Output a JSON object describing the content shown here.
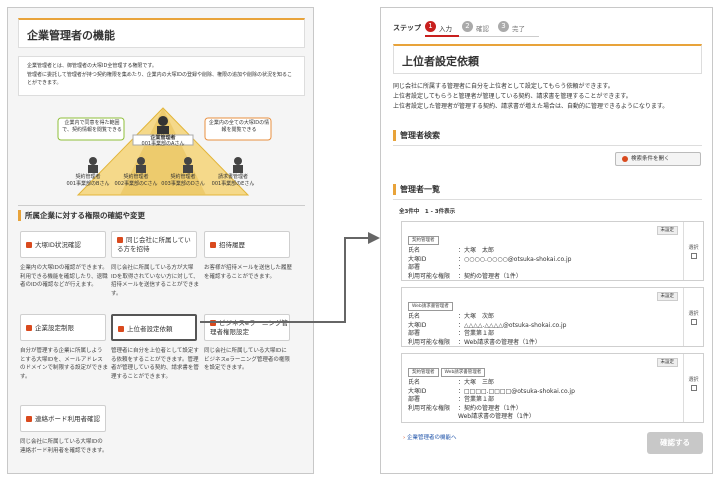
{
  "left": {
    "title": "企業管理者の機能",
    "intro": "企業管理者とは、御管理者の大塚ID全管理する権限です。\n管理者に委託して管理者が持つ契約権限を集めたり、企業内の大塚IDの登録や削除、権限の追加や削除の状況を知ることができます。",
    "diagram": {
      "bubble_left": "企業内で同意を得た範囲で、契約情報を閲覧できる",
      "bubble_right": "企業内の全ての大塚IDの情報を閲覧できる",
      "top_role": "企業管理者",
      "top_name": "001事業部のAさん",
      "people": [
        {
          "role": "契約管理者",
          "name": "001事業部のBさん"
        },
        {
          "role": "契約管理者",
          "name": "002事業部のCさん"
        },
        {
          "role": "契約管理者",
          "name": "003事業部のDさん"
        },
        {
          "role": "請求書管理者",
          "name": "001事業部のEさん"
        }
      ]
    },
    "section_title": "所属企業に対する権限の確認や変更",
    "cards": [
      {
        "label": "大塚ID状況確認",
        "desc": "企業内の大塚IDの確認ができます。利用できる機能を確認したり、退職者のIDの確認などが行えます。"
      },
      {
        "label": "同じ会社に所属している方を招待",
        "desc": "同じ会社に所属している方が大塚IDを取得されていない方に対して、招待メールを送信することができます。"
      },
      {
        "label": "招待履歴",
        "desc": "お客様が招待メールを送信した履歴を確認することができます。"
      },
      {
        "label": "企業設定制限",
        "desc": "自分が管理する企業に所属しようとする大塚IDを、メールアドレスのドメインで制限する設定ができます。"
      },
      {
        "label": "上位者設定依頼",
        "desc": "管理者に自分を上位者として設定する依頼をすることができます。管理者が管理している契約、請求書を管理することができます。"
      },
      {
        "label": "ビジネスeラーニング管理者権限設定",
        "desc": "同じ会社に所属している大塚IDにビジネスeラーニング管理者の権限を設定できます。"
      },
      {
        "label": "連絡ボード利用者確認",
        "desc": "同じ会社に所属している大塚IDの連絡ボード利用者を確認できます。"
      }
    ]
  },
  "right": {
    "step_label": "ステップ",
    "steps": [
      {
        "num": "1",
        "label": "入力"
      },
      {
        "num": "2",
        "label": "確認"
      },
      {
        "num": "3",
        "label": "完了"
      }
    ],
    "title": "上位者設定依頼",
    "desc": "同じ会社に所属する管理者に自分を上位者として設定してもらう依頼ができます。\n上位者設定してもらうと管理者が管理している契約、請求書を管理することができます。\n上位者設定した管理者が管理する契約、請求書が増えた場合は、自動的に管理できるようになります。",
    "search_title": "管理者検索",
    "search_button": "検索条件を開く",
    "list_title": "管理者一覧",
    "count_text": "全3件中　1 - 3件表示",
    "unset_label": "未設定",
    "select_label": "選択",
    "field_labels": {
      "name": "氏名",
      "id": "大塚ID",
      "dept": "部署",
      "func": "利用可能な権限"
    },
    "results": [
      {
        "tags": [
          "契約管理者"
        ],
        "name": "：大塚　太郎",
        "id": "：○○○○.○○○○@otsuka-shokai.co.jp",
        "dept": "：",
        "func": [
          "：契約の管理者（1件）"
        ]
      },
      {
        "tags": [
          "Web請求書管理者"
        ],
        "name": "：大塚　次郎",
        "id": "：△△△△.△△△△@otsuka-shokai.co.jp",
        "dept": "：営業第１部",
        "func": [
          "：Web請求書の管理者（1件）"
        ]
      },
      {
        "tags": [
          "契約管理者",
          "Web請求書管理者"
        ],
        "name": "：大塚　三郎",
        "id": "：□□□□.□□□□@otsuka-shokai.co.jp",
        "dept": "：営業第１部",
        "func": [
          "：契約の管理者（1件）",
          "Web請求書の管理者（1件）"
        ]
      }
    ],
    "link_text": "企業管理者の機能へ",
    "confirm_button": "確認する"
  },
  "colors": {
    "accent": "#e8a33a",
    "step_active": "#c8201e",
    "confirm_btn": "#c8c8c8"
  }
}
